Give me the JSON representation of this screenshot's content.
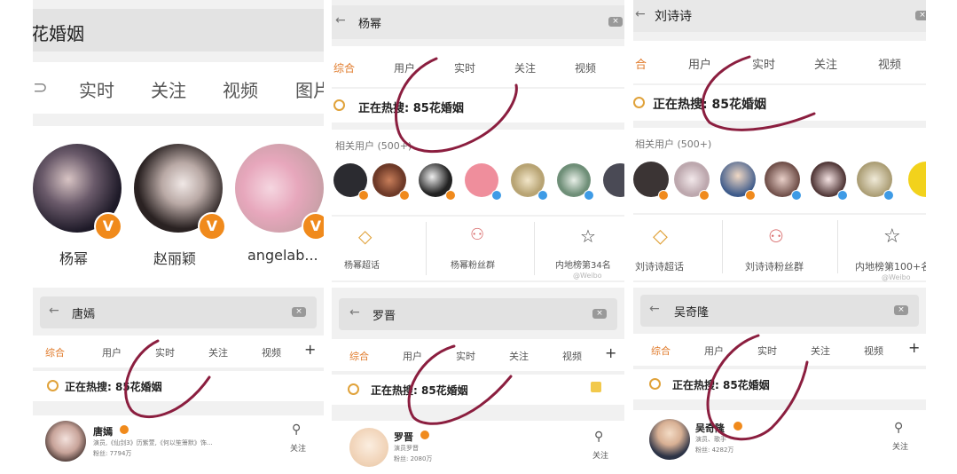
{
  "p1": {
    "search_text": "花婚姻",
    "tabs": [
      "实时",
      "关注",
      "视频",
      "图片"
    ],
    "users": [
      "杨幂",
      "赵丽颖",
      "angelab..."
    ],
    "v_badge": "V"
  },
  "p2": {
    "search_text": "唐嫣",
    "tabs": [
      "综合",
      "用户",
      "实时",
      "关注",
      "视频",
      "+"
    ],
    "hot": "正在热搜: 85花婚姻",
    "user_name": "唐嫣",
    "user_desc": "演员,《仙剑3》历紫萱,《何以笙箫默》饰...",
    "user_fans": "粉丝: 7794万",
    "follow": "关注"
  },
  "p3": {
    "search_text": "杨幂",
    "tabs": [
      "综合",
      "用户",
      "实时",
      "关注",
      "视频"
    ],
    "hot": "正在热搜: 85花婚姻",
    "related": "相关用户 (500+)",
    "cards": [
      "杨幂超话",
      "杨幂粉丝群",
      "内地榜第34名"
    ],
    "watermark": "@Weibo"
  },
  "p4": {
    "search_text": "罗晋",
    "tabs": [
      "综合",
      "用户",
      "实时",
      "关注",
      "视频",
      "+"
    ],
    "hot": "正在热搜: 85花婚姻",
    "user_name": "罗晋",
    "user_desc": "演员罗晋",
    "user_fans": "粉丝: 2080万",
    "follow": "关注"
  },
  "p5": {
    "search_text": "刘诗诗",
    "tabs": [
      "合",
      "用户",
      "实时",
      "关注",
      "视频"
    ],
    "hot": "正在热搜: 85花婚姻",
    "related": "相关用户 (500+)",
    "cards": [
      "刘诗诗超话",
      "刘诗诗粉丝群",
      "内地榜第100+名"
    ],
    "watermark": "@Weibo"
  },
  "p6": {
    "search_text": "吴奇隆",
    "tabs": [
      "综合",
      "用户",
      "实时",
      "关注",
      "视频",
      "+"
    ],
    "hot": "正在热搜: 85花婚姻",
    "user_name": "吴奇隆",
    "user_desc": "演员、歌手",
    "user_fans": "粉丝: 4282万",
    "follow": "关注"
  },
  "colors": {
    "accent": "#e07a2a",
    "ink": "#8b1e3f",
    "verified_orange": "#f08a1c",
    "verified_blue": "#3e9be6"
  }
}
